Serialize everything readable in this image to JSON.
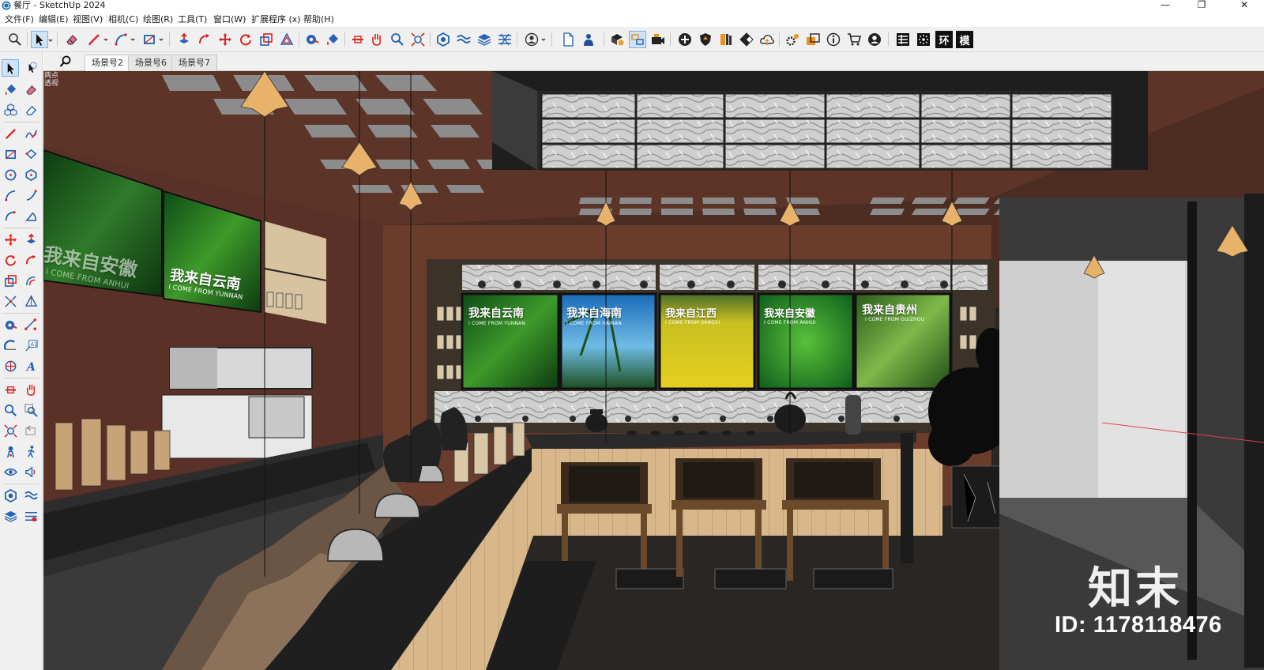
{
  "window": {
    "title": "餐厅 - SketchUp 2024",
    "controls": {
      "minimize": "—",
      "restore": "❐",
      "close": "✕"
    }
  },
  "menu": [
    "文件(F)",
    "编辑(E)",
    "视图(V)",
    "相机(C)",
    "绘图(R)",
    "工具(T)",
    "窗口(W)",
    "扩展程序 (x)",
    "帮助(H)"
  ],
  "toolbar_icons": [
    "search-icon",
    "select-icon",
    "eraser-icon",
    "pencil-icon",
    "arc-icon",
    "rectangle-icon",
    "push-pull-icon",
    "follow-me-icon",
    "move-icon",
    "rotate-icon",
    "scale-icon",
    "offset-icon",
    "tape-measure-icon",
    "paint-bucket-icon",
    "section-plane-icon",
    "walk-icon",
    "zoom-icon",
    "zoom-extents-icon",
    "warehouse-icon",
    "sandbox-icon",
    "layers-icon",
    "styles-icon",
    "user-icon",
    "new-file-icon",
    "person-icon",
    "model-info-icon",
    "swap-icon",
    "position-camera-icon",
    "add-icon",
    "shield-icon",
    "book-icon",
    "checker-icon",
    "cloud-icon",
    "gears-icon",
    "layout-icon",
    "info-icon",
    "cart-icon",
    "account-icon",
    "grid-icon",
    "starburst-icon",
    "env-icon",
    "model-icon"
  ],
  "toolbar_text_buttons": [
    "环",
    "模"
  ],
  "scene_tabs": [
    "场景号2",
    "场景号6",
    "场景号7"
  ],
  "active_scene": "场景号2",
  "viewport_labels": [
    "两点",
    "透视"
  ],
  "signs": [
    {
      "title": "我来自云南",
      "subtitle": "I COME FROM YUNNAN"
    },
    {
      "title": "我来自海南",
      "subtitle": "I COME FROM HAINAN"
    },
    {
      "title": "我来自江西",
      "subtitle": "I COME FROM JIANGXI"
    },
    {
      "title": "我来自安徽",
      "subtitle": "I COME FROM ANHUI"
    },
    {
      "title": "我来自贵州",
      "subtitle": "I COME FROM GUIZHOU"
    }
  ],
  "left_signs": [
    {
      "title": "我来自安徽",
      "subtitle": "I COME FROM ANHUI"
    },
    {
      "title": "我来自云南",
      "subtitle": "I COME FROM YUNNAN"
    }
  ],
  "watermark": {
    "logo": "知末",
    "id": "ID: 1178118476"
  },
  "colors": {
    "accent_selected": "#cfe3f7",
    "wall": "#5a3328",
    "floor": "#1f1f1f",
    "ceiling_panel": "#8a8a8a",
    "wood": "#d9b98c"
  }
}
